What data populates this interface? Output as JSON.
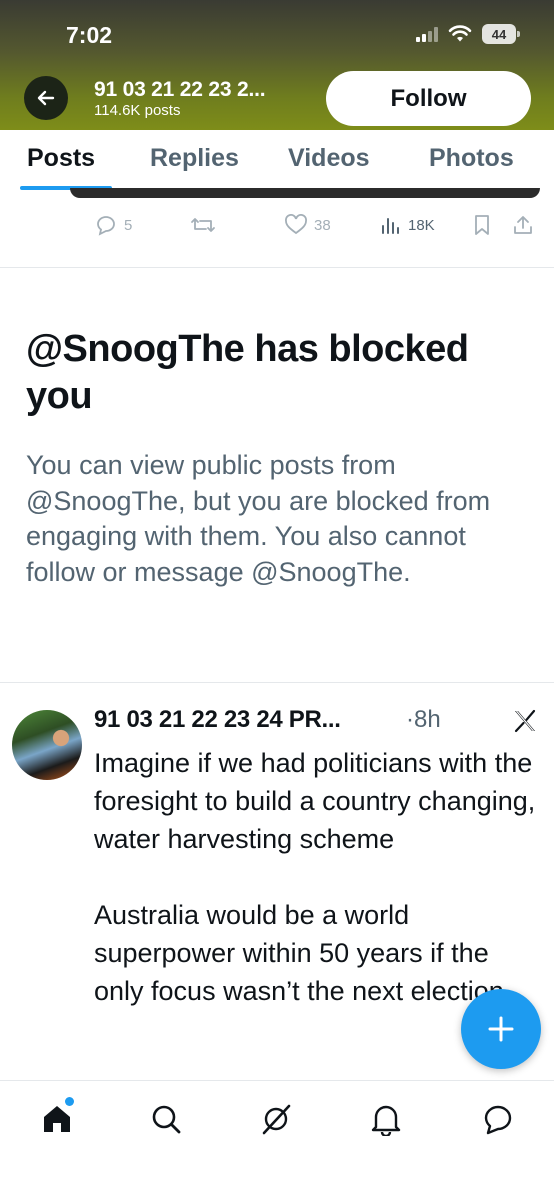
{
  "status_bar": {
    "time": "7:02",
    "battery": "44"
  },
  "header": {
    "account_name": "91 03 21 22 23 2...",
    "post_count": "114.6K posts",
    "follow_label": "Follow"
  },
  "tabs": [
    {
      "label": "Posts",
      "active": true
    },
    {
      "label": "Replies",
      "active": false
    },
    {
      "label": "Videos",
      "active": false
    },
    {
      "label": "Photos",
      "active": false
    }
  ],
  "prev_post_actions": {
    "replies": "5",
    "reposts": "",
    "likes": "38",
    "views": "18K"
  },
  "blocked_notice": {
    "title": "@SnoogThe has blocked you",
    "body": "You can view public posts from @SnoogThe, but you are blocked from engaging with them. You also cannot follow or message @SnoogThe."
  },
  "tweet": {
    "author": "91 03 21 22 23 24 PR...",
    "separator": "·",
    "time": "8h",
    "text": "Imagine if we had politicians with the foresight to build a country changing, water harvesting scheme\n\nAustralia would be a world superpower within 50 years if the only focus wasn’t the next election"
  },
  "colors": {
    "accent": "#1d9bf0",
    "text_primary": "#0f1419",
    "text_secondary": "#536471"
  },
  "icons": {
    "back": "arrow-left-icon",
    "reply": "reply-icon",
    "repost": "repost-icon",
    "like": "heart-icon",
    "views": "views-icon",
    "bookmark": "bookmark-icon",
    "share": "share-icon",
    "compose": "plus-icon",
    "home": "home-icon",
    "search": "search-icon",
    "grok": "grok-icon",
    "notifications": "bell-icon",
    "messages": "messages-icon",
    "x_logo": "x-logo-icon"
  }
}
